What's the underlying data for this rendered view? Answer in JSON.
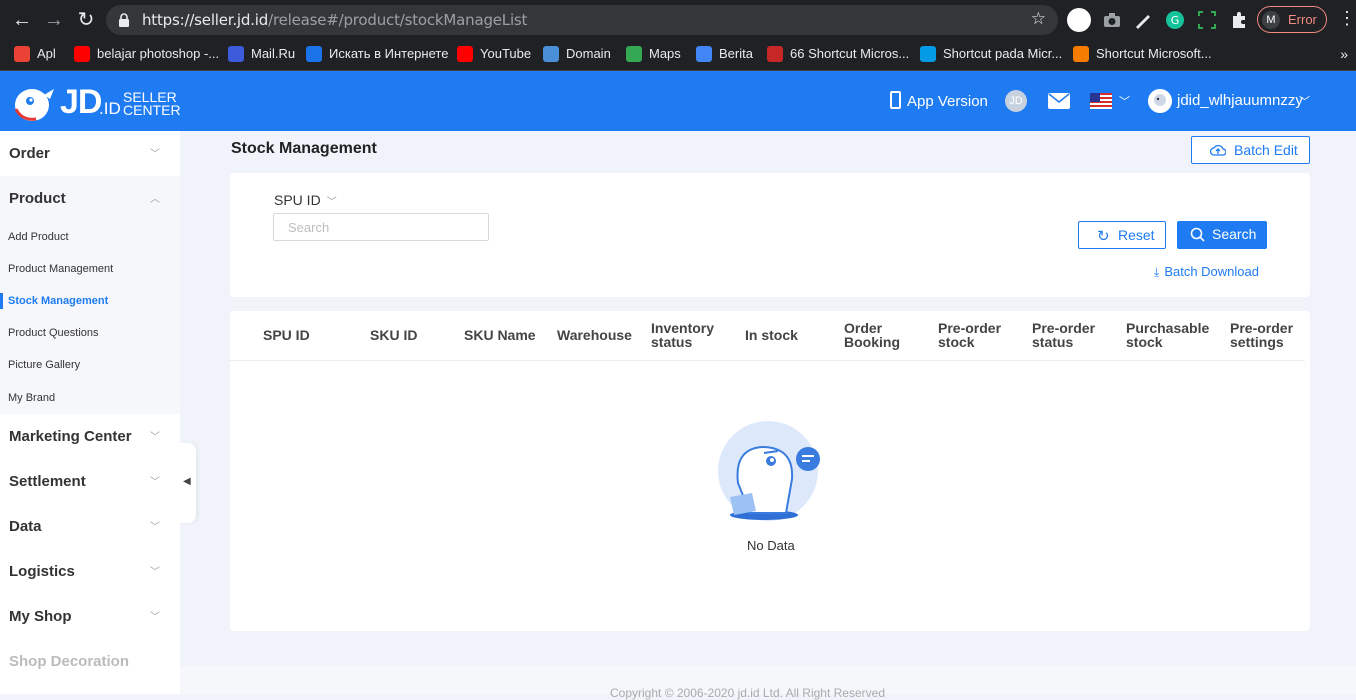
{
  "browser": {
    "url_host": "seller.jd.id",
    "url_path": "/release#/product/stockManageList",
    "url_scheme": "https://",
    "error_label": "Error",
    "bookmarks": [
      {
        "label": "Apl",
        "color": "#ea4335"
      },
      {
        "label": "belajar photoshop -...",
        "color": "#ff0000"
      },
      {
        "label": "Mail.Ru",
        "color": "#3b5bdb"
      },
      {
        "label": "Искать в Интернете",
        "color": "#1a73e8"
      },
      {
        "label": "YouTube",
        "color": "#ff0000"
      },
      {
        "label": "Domain",
        "color": "#4a90d9"
      },
      {
        "label": "Maps",
        "color": "#34a853"
      },
      {
        "label": "Berita",
        "color": "#4285f4"
      },
      {
        "label": "66 Shortcut Micros...",
        "color": "#c62828"
      },
      {
        "label": "Shortcut pada Micr...",
        "color": "#039be5"
      },
      {
        "label": "Shortcut Microsoft...",
        "color": "#f57c00"
      }
    ]
  },
  "header": {
    "logo_jd": "JD",
    "logo_id": ".ID",
    "logo_seller": "SELLER",
    "logo_center": "CENTER",
    "app_version": "App Version",
    "jd_badge": "JD",
    "username": "jdid_wlhjauumnzzy"
  },
  "sidebar": {
    "groups": [
      {
        "label": "Order"
      },
      {
        "label": "Product"
      },
      {
        "label": "Marketing Center"
      },
      {
        "label": "Settlement"
      },
      {
        "label": "Data"
      },
      {
        "label": "Logistics"
      },
      {
        "label": "My Shop"
      },
      {
        "label": "Shop Decoration"
      }
    ],
    "product_items": [
      {
        "label": "Add Product"
      },
      {
        "label": "Product Management"
      },
      {
        "label": "Stock Management"
      },
      {
        "label": "Product Questions"
      },
      {
        "label": "Picture Gallery"
      },
      {
        "label": "My Brand"
      }
    ]
  },
  "main": {
    "title": "Stock Management",
    "batch_edit": "Batch Edit",
    "filter": {
      "field_label": "SPU ID",
      "search_placeholder": "Search",
      "reset": "Reset",
      "search": "Search",
      "batch_download": "Batch Download"
    },
    "table": {
      "columns": [
        [
          "SPU ID"
        ],
        [
          "SKU ID"
        ],
        [
          "SKU Name"
        ],
        [
          "Warehouse"
        ],
        [
          "Inventory",
          "status"
        ],
        [
          "In stock"
        ],
        [
          "Order",
          "Booking"
        ],
        [
          "Pre-order",
          "stock"
        ],
        [
          "Pre-order",
          "status"
        ],
        [
          "Purchasable",
          "stock"
        ],
        [
          "Pre-order",
          "settings"
        ]
      ],
      "empty_text": "No Data"
    },
    "footer": "Copyright © 2006-2020 jd.id Ltd. All Right Reserved"
  },
  "colors": {
    "brand_blue": "#1e7bf2",
    "page_bg": "#f0f4fa",
    "chrome_dark": "#202124"
  }
}
